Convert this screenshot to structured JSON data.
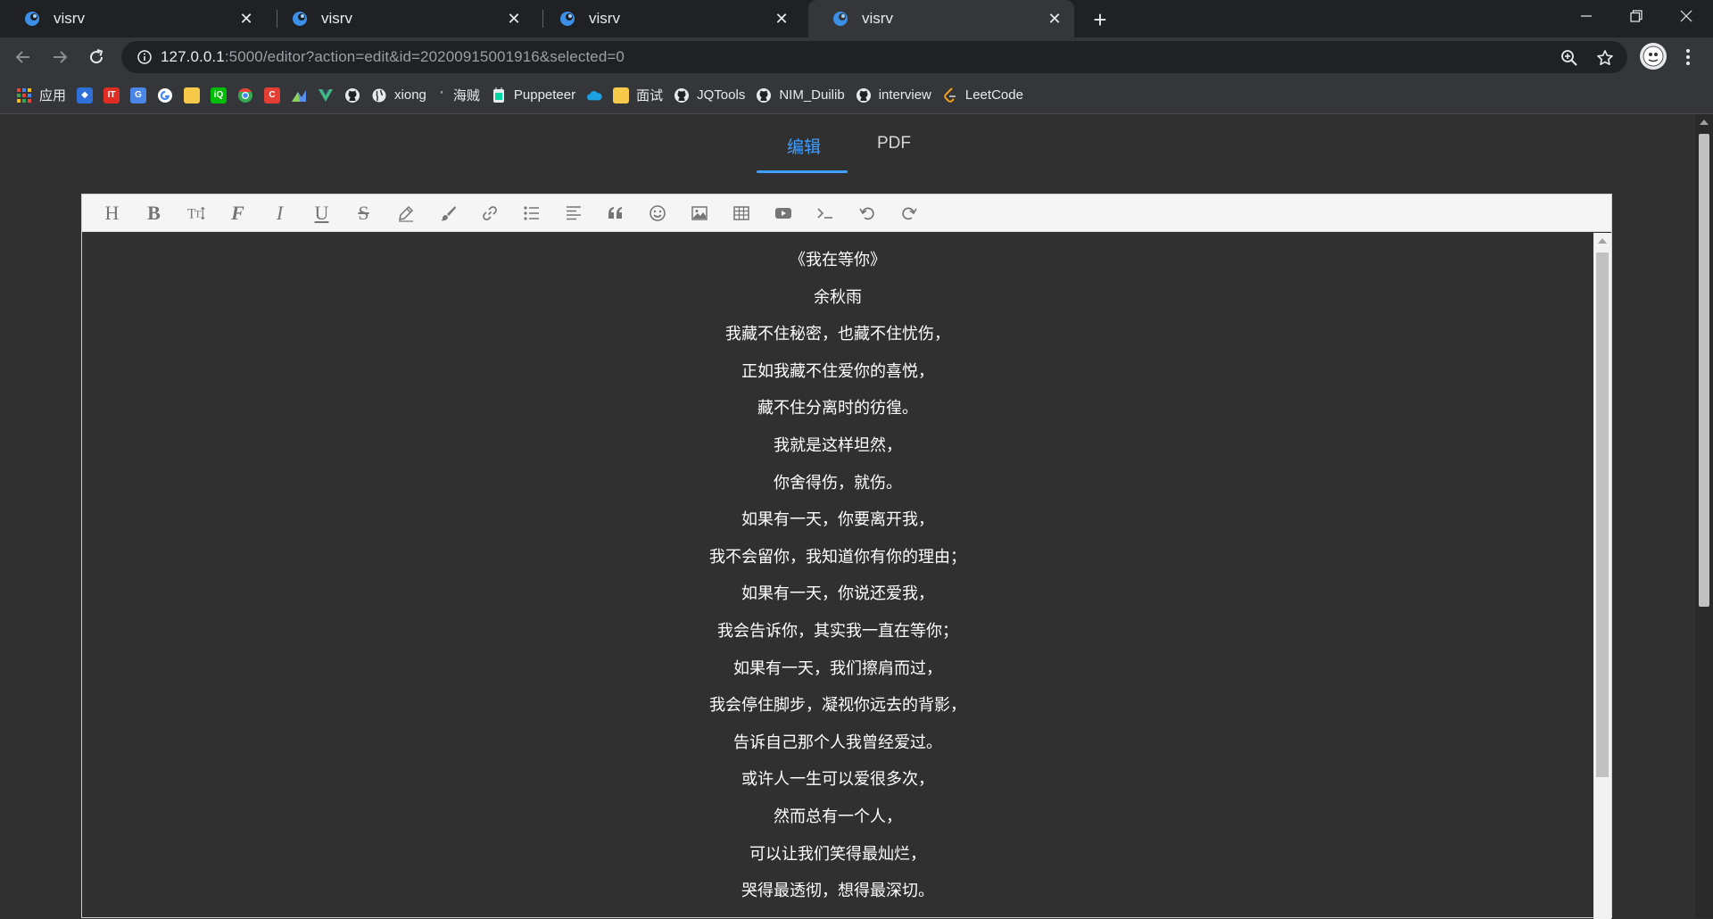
{
  "browser": {
    "tabs": [
      {
        "title": "visrv"
      },
      {
        "title": "visrv"
      },
      {
        "title": "visrv"
      },
      {
        "title": "visrv"
      }
    ],
    "url_host": "127.0.0.1",
    "url_rest": ":5000/editor?action=edit&id=20200915001916&selected=0",
    "bookmarks": {
      "apps": "应用",
      "xiong": "xiong",
      "haizei": "海贼",
      "puppeteer": "Puppeteer",
      "mianshi": "面试",
      "jqtools": "JQTools",
      "nim": "NIM_Duilib",
      "interview": "interview",
      "leetcode": "LeetCode"
    }
  },
  "page": {
    "tab_edit": "编辑",
    "tab_pdf": "PDF"
  },
  "editor": {
    "lines": [
      "《我在等你》",
      "余秋雨",
      "我藏不住秘密，也藏不住忧伤，",
      "正如我藏不住爱你的喜悦，",
      "藏不住分离时的彷徨。",
      "我就是这样坦然，",
      "你舍得伤，就伤。",
      "如果有一天，你要离开我，",
      "我不会留你，我知道你有你的理由；",
      "如果有一天，你说还爱我，",
      "我会告诉你，其实我一直在等你；",
      "如果有一天，我们擦肩而过，",
      "我会停住脚步，凝视你远去的背影，",
      "告诉自己那个人我曾经爱过。",
      "或许人一生可以爱很多次，",
      "然而总有一个人，",
      "可以让我们笑得最灿烂，",
      "哭得最透彻，想得最深切。"
    ]
  },
  "colors": {
    "accent": "#409eff",
    "page_bg": "#303030",
    "chrome_tabstrip": "#202124",
    "chrome_toolbar": "#35363a"
  }
}
